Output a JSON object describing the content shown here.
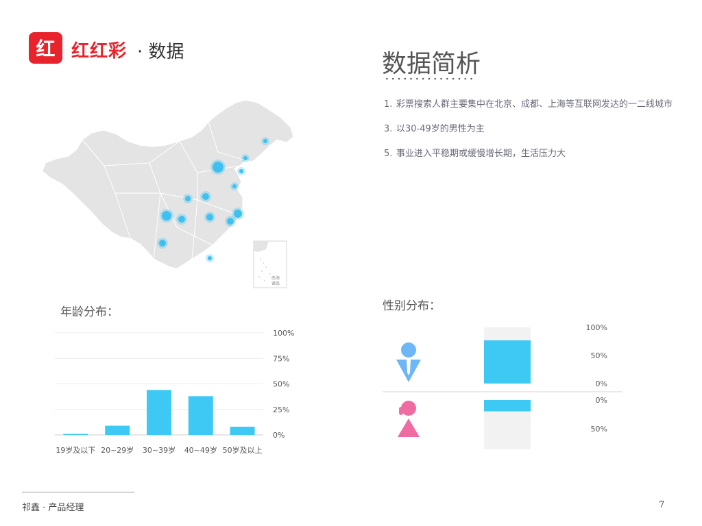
{
  "header": {
    "logo_char": "红",
    "brand_name": "红红彩",
    "brand_suffix": "· 数据"
  },
  "analysis": {
    "title": "数据简析",
    "items": [
      {
        "num": "1.",
        "text": "彩票搜索人群主要集中在北京、成都、上海等互联网发达的一二线城市"
      },
      {
        "num": "3.",
        "text": "以30-49岁的男性为主"
      },
      {
        "num": "5.",
        "text": "事业进入平稳期或缓慢增长期，生活压力大"
      }
    ]
  },
  "map": {
    "labels": [
      "南海",
      "诸岛"
    ],
    "hotspot_color": "#3ec1f0",
    "land_color": "#e4e4e4"
  },
  "age_section": {
    "title": "年龄分布："
  },
  "gender_section": {
    "title": "性别分布："
  },
  "chart_data": [
    {
      "type": "bar",
      "title": "年龄分布：",
      "categories": [
        "19岁及以下",
        "20~29岁",
        "30~39岁",
        "40~49岁",
        "50岁及以上"
      ],
      "values": [
        1,
        9,
        44,
        38,
        8
      ],
      "ylim": [
        0,
        100
      ],
      "yticks": [
        "100%",
        "75%",
        "50%",
        "25%",
        "0%"
      ],
      "grid": true,
      "bar_color": "#3ec8f4"
    },
    {
      "type": "bar",
      "title": "性别分布：",
      "series": [
        {
          "values": [
            77
          ],
          "icon": "male-icon",
          "icon_color": "#6db6f7"
        },
        {
          "values": [
            23
          ],
          "icon": "female-icon",
          "icon_color": "#f06ba2"
        }
      ],
      "ylim": [
        0,
        100
      ],
      "top_ticks": [
        "100%",
        "50%",
        "0%"
      ],
      "bottom_ticks": [
        "0%",
        "50%"
      ],
      "bar_color": "#3ec8f4",
      "track_color": "#f2f2f2"
    }
  ],
  "footer": {
    "author": "祁鑫 · 产品经理",
    "page": "7"
  }
}
